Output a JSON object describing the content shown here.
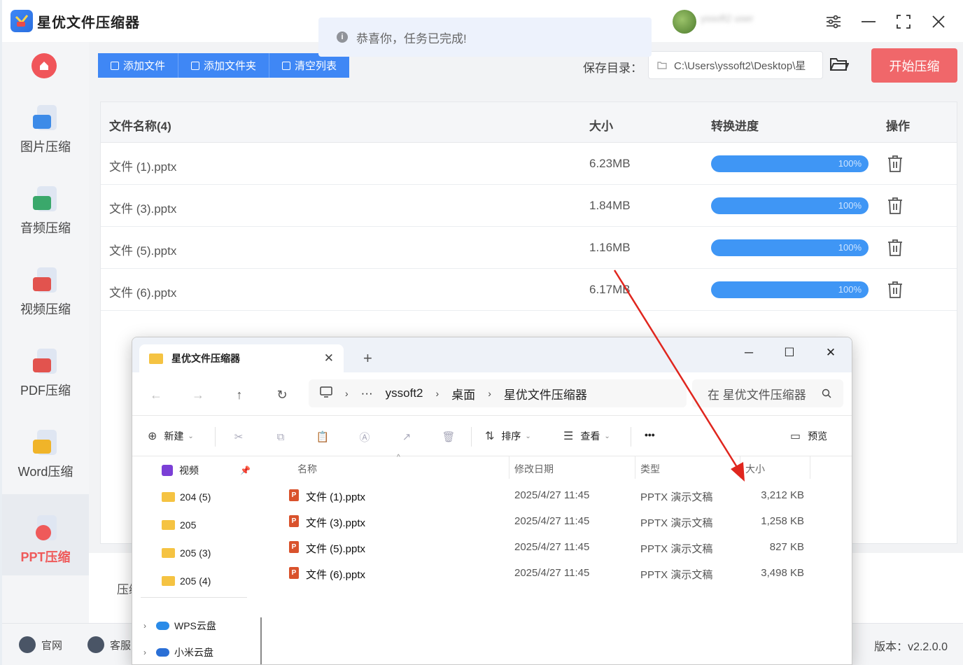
{
  "app": {
    "title": "星优文件压缩器",
    "username": "yssoft2 user",
    "notice": "恭喜你，任务已完成!"
  },
  "sidebar": {
    "items": [
      {
        "label": "图片压缩",
        "color": "#3d8be8"
      },
      {
        "label": "音频压缩",
        "color": "#3aa86b"
      },
      {
        "label": "视频压缩",
        "color": "#e2534e"
      },
      {
        "label": "PDF压缩",
        "color": "#e2534e"
      },
      {
        "label": "Word压缩",
        "color": "#f0b429"
      },
      {
        "label": "PPT压缩",
        "color": "#ef5a5a"
      }
    ],
    "active": "PPT压缩"
  },
  "toolbar": {
    "add_file": "添加文件",
    "add_folder": "添加文件夹",
    "clear_list": "清空列表",
    "save_label": "保存目录：",
    "save_path": "C:\\Users\\yssoft2\\Desktop\\星",
    "start": "开始压缩"
  },
  "table": {
    "headers": {
      "name": "文件名称(4)",
      "size": "大小",
      "progress": "转换进度",
      "action": "操作"
    },
    "rows": [
      {
        "name": "文件 (1).pptx",
        "size": "6.23MB",
        "progress": "100%"
      },
      {
        "name": "文件 (3).pptx",
        "size": "1.84MB",
        "progress": "100%"
      },
      {
        "name": "文件 (5).pptx",
        "size": "1.16MB",
        "progress": "100%"
      },
      {
        "name": "文件 (6).pptx",
        "size": "6.17MB",
        "progress": "100%"
      }
    ]
  },
  "bottom": {
    "label": "压缩"
  },
  "footer": {
    "website": "官网",
    "support": "客服",
    "version": "版本：v2.2.0.0"
  },
  "explorer": {
    "tab_title": "星优文件压缩器",
    "breadcrumb": [
      "yssoft2",
      "桌面",
      "星优文件压缩器"
    ],
    "search_placeholder": "在 星优文件压缩器",
    "commands": {
      "new": "新建",
      "sort": "排序",
      "view": "查看",
      "more": "•••",
      "preview": "预览"
    },
    "nav_items": [
      "视频",
      "204 (5)",
      "205",
      "205 (3)",
      "205 (4)",
      "WPS云盘",
      "小米云盘"
    ],
    "columns": {
      "name": "名称",
      "modified": "修改日期",
      "type": "类型",
      "size": "大小"
    },
    "files": [
      {
        "name": "文件 (1).pptx",
        "date": "2025/4/27 11:45",
        "type": "PPTX 演示文稿",
        "size": "3,212 KB"
      },
      {
        "name": "文件 (3).pptx",
        "date": "2025/4/27 11:45",
        "type": "PPTX 演示文稿",
        "size": "1,258 KB"
      },
      {
        "name": "文件 (5).pptx",
        "date": "2025/4/27 11:45",
        "type": "PPTX 演示文稿",
        "size": "827 KB"
      },
      {
        "name": "文件 (6).pptx",
        "date": "2025/4/27 11:45",
        "type": "PPTX 演示文稿",
        "size": "3,498 KB"
      }
    ]
  },
  "colors": {
    "primary": "#3f87f5",
    "accent": "#f0676a",
    "progress": "#3f96f5"
  }
}
